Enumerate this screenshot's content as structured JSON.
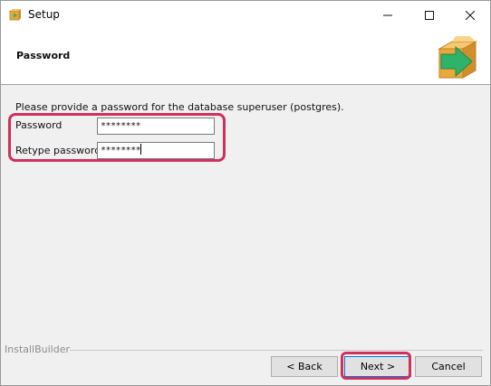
{
  "window": {
    "title": "Setup",
    "controls": {
      "minimize": "—",
      "maximize": "☐",
      "close": "✕"
    }
  },
  "header": {
    "title": "Password",
    "icon": "install-box-arrow-icon"
  },
  "form": {
    "prompt": "Please provide a password for the database superuser (postgres).",
    "password_label": "Password",
    "password_value": "********",
    "retype_label": "Retype password",
    "retype_value": "********"
  },
  "footer": {
    "brand": "InstallBuilder",
    "back_label": "< Back",
    "next_label": "Next >",
    "cancel_label": "Cancel"
  },
  "colors": {
    "highlight": "#d0305c",
    "box_orange": "#e8a83a",
    "arrow_green": "#2fb36a",
    "focus_blue": "#0078d7"
  }
}
